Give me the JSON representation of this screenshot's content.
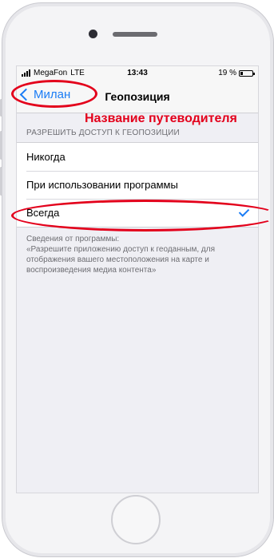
{
  "status_bar": {
    "carrier": "MegaFon",
    "network": "LTE",
    "time": "13:43",
    "battery": "19 %"
  },
  "nav": {
    "back_label": "Милан",
    "title": "Геопозиция"
  },
  "section": {
    "header": "РАЗРЕШИТЬ ДОСТУП К ГЕОПОЗИЦИИ",
    "options": [
      {
        "label": "Никогда",
        "selected": false
      },
      {
        "label": "При использовании программы",
        "selected": false
      },
      {
        "label": "Всегда",
        "selected": true
      }
    ],
    "footer_title": "Сведения от программы:",
    "footer_text": "«Разрешите приложению доступ к геоданным, для отображения вашего местоположения на карте и воспроизведения медиа контента»"
  },
  "annotation": {
    "label": "Название путеводителя",
    "color": "#e3001b"
  },
  "colors": {
    "accent": "#1a7cf5",
    "background": "#efeff4"
  }
}
